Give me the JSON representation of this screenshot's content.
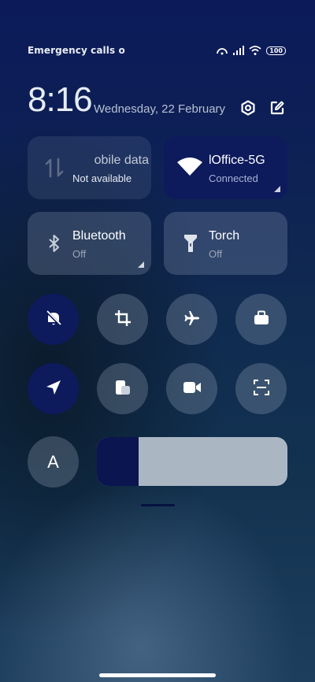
{
  "status_bar": {
    "carrier_text": "Emergency calls o",
    "battery": "100",
    "icons": [
      "hotspot-icon",
      "signal-icon",
      "wifi-icon",
      "battery-icon"
    ]
  },
  "header": {
    "time": "8:16",
    "date": "Wednesday, 22 February",
    "settings_icon": "settings-icon",
    "edit_icon": "edit-icon"
  },
  "tiles": {
    "mobile_data": {
      "title": "obile data",
      "status": "Not available",
      "active": false
    },
    "wifi": {
      "title": "lOffice-5G",
      "status": "Connected",
      "active": true
    },
    "bluetooth": {
      "title": "Bluetooth",
      "status": "Off",
      "active": false
    },
    "torch": {
      "title": "Torch",
      "status": "Off",
      "active": false
    }
  },
  "toggles": [
    {
      "name": "silent",
      "icon": "bell-off-icon",
      "active": true
    },
    {
      "name": "screenshot",
      "icon": "crop-icon",
      "active": false
    },
    {
      "name": "airplane-mode",
      "icon": "airplane-icon",
      "active": false
    },
    {
      "name": "work",
      "icon": "briefcase-icon",
      "active": false
    },
    {
      "name": "location",
      "icon": "location-arrow-icon",
      "active": true
    },
    {
      "name": "floating-window",
      "icon": "floating-window-icon",
      "active": false
    },
    {
      "name": "screen-recorder",
      "icon": "video-camera-icon",
      "active": false
    },
    {
      "name": "scanner",
      "icon": "scan-icon",
      "active": false
    }
  ],
  "auto_brightness": {
    "label": "A"
  },
  "brightness_level": 0.22,
  "colors": {
    "active": "#0d1a5c",
    "brightness_track": "#aab7c3"
  }
}
